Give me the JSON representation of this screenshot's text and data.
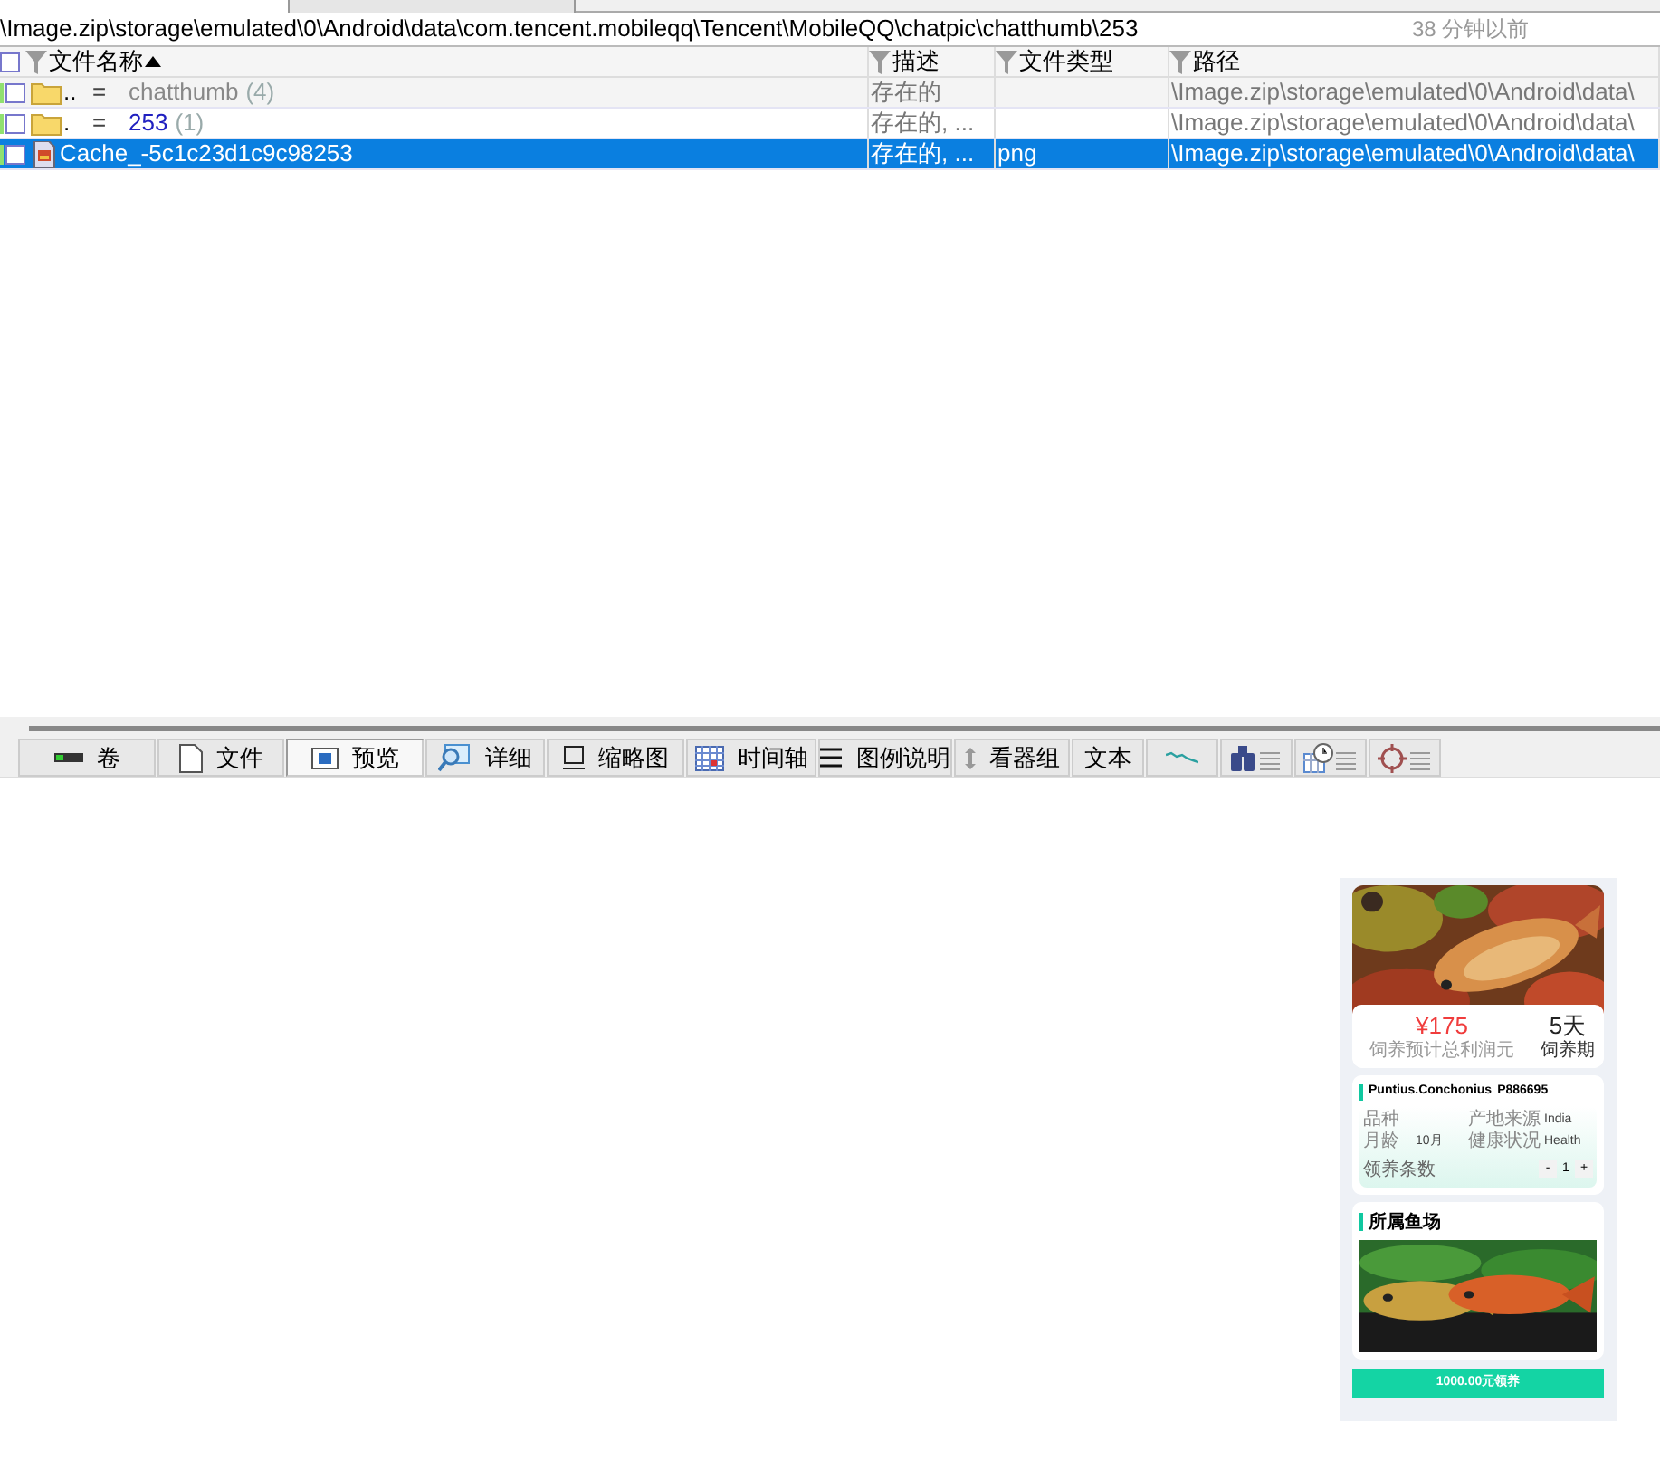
{
  "path_bar": {
    "path": "\\Image.zip\\storage\\emulated\\0\\Android\\data\\com.tencent.mobileqq\\Tencent\\MobileQQ\\chatpic\\chatthumb\\253",
    "time": "38 分钟以前"
  },
  "table": {
    "all_checked": false,
    "columns": [
      {
        "label": "文件名称",
        "sorted": true
      },
      {
        "label": "描述",
        "sorted": false
      },
      {
        "label": "文件类型",
        "sorted": false
      },
      {
        "label": "路径",
        "sorted": false
      }
    ],
    "rows": [
      {
        "kind": "parent",
        "marker": "..",
        "eq": "=",
        "name": "chatthumb",
        "count": "(4)",
        "description": "存在的",
        "path": "\\Image.zip\\storage\\emulated\\0\\Android\\data\\",
        "checked": false,
        "selected": false
      },
      {
        "kind": "current",
        "marker": ".",
        "eq": "=",
        "name": "253",
        "count": "(1)",
        "description": "存在的, ...",
        "path": "\\Image.zip\\storage\\emulated\\0\\Android\\data\\",
        "checked": false,
        "selected": false
      },
      {
        "kind": "file",
        "name": "Cache_-5c1c23d1c9c98253",
        "description": "存在的, ...",
        "type": "png",
        "path": "\\Image.zip\\storage\\emulated\\0\\Android\\data\\",
        "checked": false,
        "selected": true
      }
    ]
  },
  "toolbar": [
    {
      "kind": "volume",
      "label": "卷",
      "selected": false
    },
    {
      "kind": "file",
      "label": "文件",
      "selected": false
    },
    {
      "kind": "preview",
      "label": "预览",
      "selected": true
    },
    {
      "kind": "details",
      "label": "详细",
      "selected": false
    },
    {
      "kind": "thumbs",
      "label": "缩略图",
      "selected": false
    },
    {
      "kind": "timeline",
      "label": "时间轴",
      "selected": false
    },
    {
      "kind": "legend",
      "label": "图例说明",
      "selected": false
    },
    {
      "kind": "viewers",
      "label": "看器组",
      "selected": false
    },
    {
      "kind": "text",
      "label": "文本",
      "selected": false
    },
    {
      "kind": "wave",
      "selected": false
    },
    {
      "kind": "binoculars",
      "selected": false
    },
    {
      "kind": "calendar",
      "selected": false
    },
    {
      "kind": "target",
      "selected": false
    }
  ],
  "preview": {
    "price": "¥175",
    "price_label": "饲养预计总利润元",
    "days": "5天",
    "days_label": "饲养期",
    "fish_name": "Puntius.Conchonius",
    "fish_code": "P886695",
    "specs": [
      {
        "label": "品种"
      },
      {
        "label": "产地来源",
        "value": "India"
      },
      {
        "label": "月龄",
        "value": "10月"
      },
      {
        "label": "健康状况",
        "value": "Health"
      }
    ],
    "quantity_label": "领养条数",
    "minus": "-",
    "quantity": "1",
    "plus": "+",
    "farm_title": "所属鱼场",
    "adopt_button": "1000.00元领养"
  }
}
